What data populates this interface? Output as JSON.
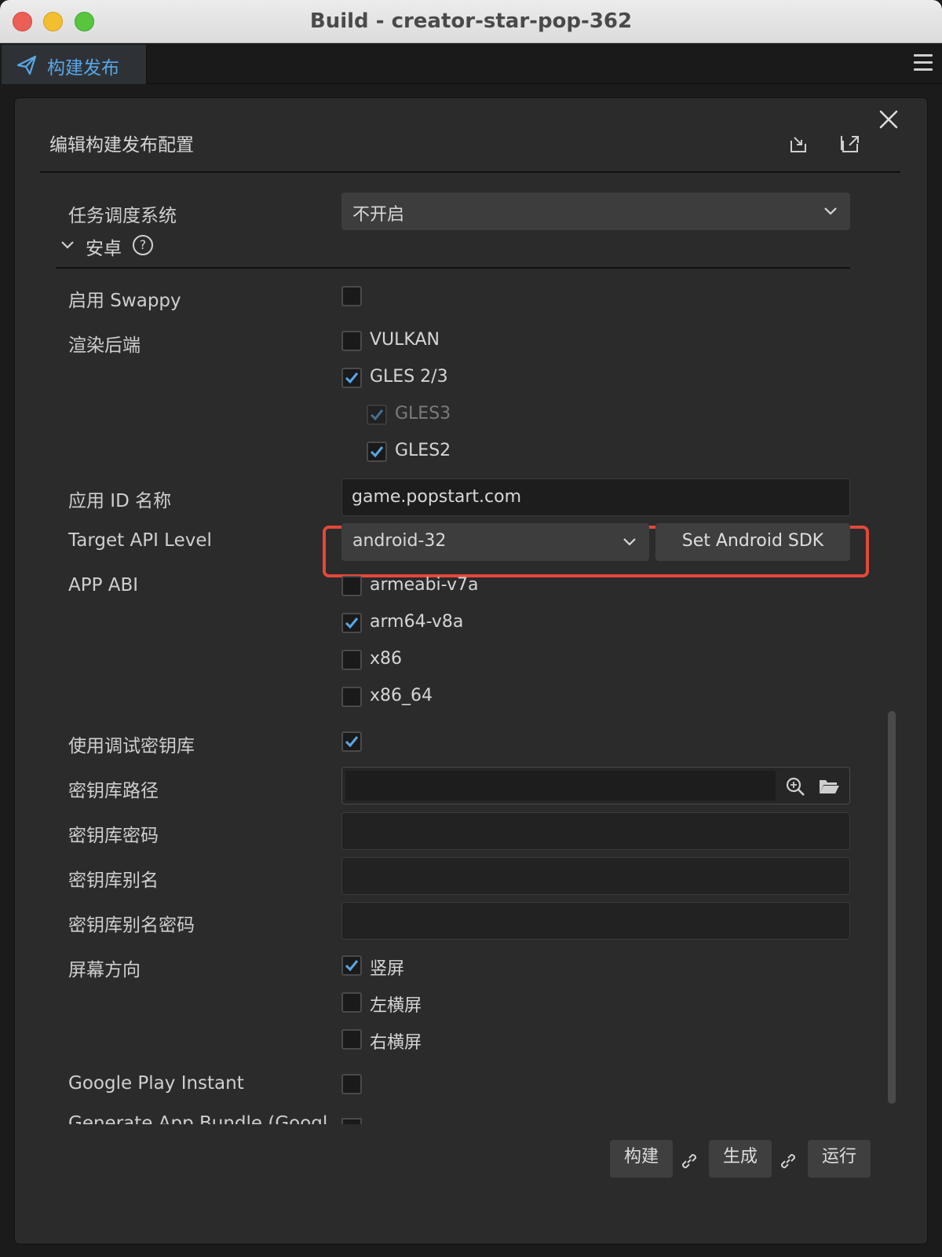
{
  "window": {
    "title": "Build - creator-star-pop-362"
  },
  "tab": {
    "label": "构建发布"
  },
  "panel": {
    "title": "编辑构建发布配置"
  },
  "task_scheduler": {
    "label": "任务调度系统",
    "value": "不开启"
  },
  "android_section": {
    "label": "安卓",
    "help": "?"
  },
  "swappy": {
    "label": "启用 Swappy",
    "checked": false
  },
  "render_backend": {
    "label": "渲染后端",
    "options": [
      {
        "label": "VULKAN",
        "checked": false
      },
      {
        "label": "GLES 2/3",
        "checked": true
      },
      {
        "label": "GLES3",
        "checked": true,
        "disabled": true
      },
      {
        "label": "GLES2",
        "checked": true
      }
    ]
  },
  "app_id": {
    "label": "应用 ID 名称",
    "value": "game.popstart.com"
  },
  "target_api": {
    "label": "Target API Level",
    "value": "android-32",
    "sdk_button": "Set Android SDK"
  },
  "app_abi": {
    "label": "APP ABI",
    "options": [
      {
        "label": "armeabi-v7a",
        "checked": false
      },
      {
        "label": "arm64-v8a",
        "checked": true
      },
      {
        "label": "x86",
        "checked": false
      },
      {
        "label": "x86_64",
        "checked": false
      }
    ]
  },
  "debug_keystore": {
    "label": "使用调试密钥库",
    "checked": true
  },
  "keystore_path": {
    "label": "密钥库路径",
    "value": ""
  },
  "keystore_password": {
    "label": "密钥库密码",
    "value": ""
  },
  "keystore_alias": {
    "label": "密钥库别名",
    "value": ""
  },
  "keystore_alias_password": {
    "label": "密钥库别名密码",
    "value": ""
  },
  "orientation": {
    "label": "屏幕方向",
    "options": [
      {
        "label": "竖屏",
        "checked": true
      },
      {
        "label": "左横屏",
        "checked": false
      },
      {
        "label": "右横屏",
        "checked": false
      }
    ]
  },
  "google_play_instant": {
    "label": "Google Play Instant",
    "checked": false
  },
  "app_bundle": {
    "label": "Generate App Bundle (Googl"
  },
  "footer": {
    "build": "构建",
    "generate": "生成",
    "run": "运行"
  },
  "colors": {
    "accent": "#5aa7e6",
    "highlight": "#e3483b",
    "panel_bg": "#2b2b2b"
  }
}
